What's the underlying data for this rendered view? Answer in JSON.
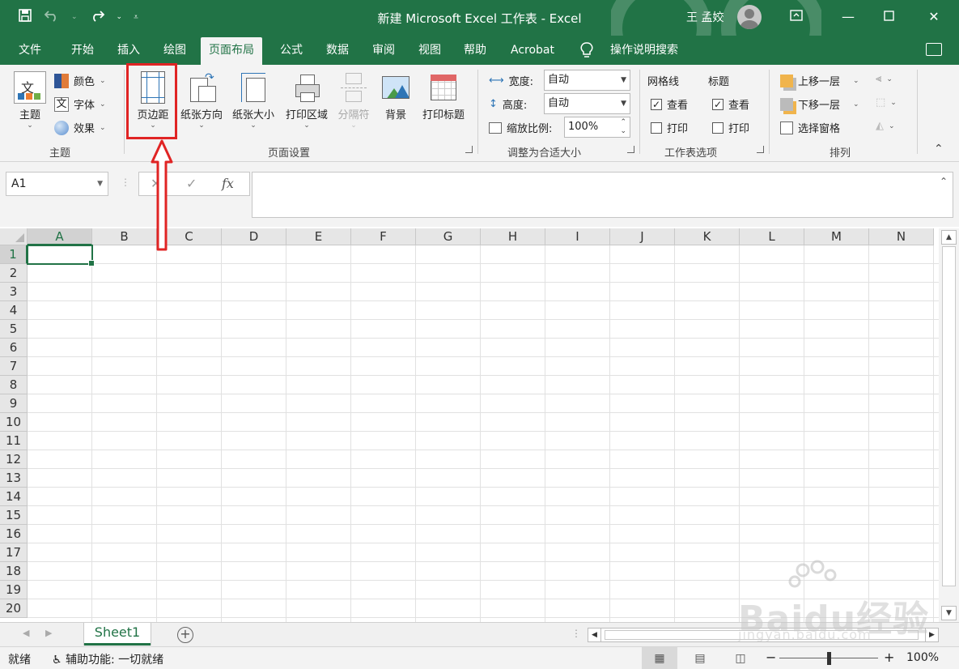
{
  "window": {
    "title": "新建 Microsoft Excel 工作表 - Excel",
    "user": "王 孟姣"
  },
  "tabs": [
    "文件",
    "开始",
    "插入",
    "绘图",
    "页面布局",
    "公式",
    "数据",
    "审阅",
    "视图",
    "帮助",
    "Acrobat",
    "操作说明搜索"
  ],
  "active_tab": "页面布局",
  "ribbon": {
    "theme": {
      "label": "主题",
      "theme_button": "主题",
      "colors": "颜色",
      "fonts": "字体",
      "effects": "效果",
      "theme_icon_glyph": "文"
    },
    "page_setup": {
      "label": "页面设置",
      "margins": "页边距",
      "orientation": "纸张方向",
      "size": "纸张大小",
      "print_area": "打印区域",
      "breaks": "分隔符",
      "background": "背景",
      "print_titles": "打印标题"
    },
    "scale_to_fit": {
      "label": "调整为合适大小",
      "width_label": "宽度:",
      "width_value": "自动",
      "height_label": "高度:",
      "height_value": "自动",
      "scale_label": "缩放比例:",
      "scale_value": "100%"
    },
    "sheet_options": {
      "label": "工作表选项",
      "gridlines": "网格线",
      "headings": "标题",
      "view": "查看",
      "print": "打印",
      "gridlines_view_checked": true,
      "gridlines_print_checked": false,
      "headings_view_checked": true,
      "headings_print_checked": false
    },
    "arrange": {
      "label": "排列",
      "bring_forward": "上移一层",
      "send_backward": "下移一层",
      "selection_pane": "选择窗格"
    }
  },
  "formula_bar": {
    "name_box": "A1",
    "cancel_glyph": "✕",
    "enter_glyph": "✓",
    "fx": "fx",
    "value": ""
  },
  "grid": {
    "columns": [
      "A",
      "B",
      "C",
      "D",
      "E",
      "F",
      "G",
      "H",
      "I",
      "J",
      "K",
      "L",
      "M",
      "N"
    ],
    "rows": [
      "1",
      "2",
      "3",
      "4",
      "5",
      "6",
      "7",
      "8",
      "9",
      "10",
      "11",
      "12",
      "13",
      "14",
      "15",
      "16",
      "17",
      "18",
      "19",
      "20"
    ],
    "active_cell": "A1"
  },
  "sheets": [
    "Sheet1"
  ],
  "status": {
    "ready": "就绪",
    "accessibility": "辅助功能: 一切就绪",
    "zoom": "100%"
  },
  "watermark": {
    "brand": "Baidu经验",
    "url": "jingyan.baidu.com"
  },
  "colors": {
    "excel_green": "#217346",
    "annotation_red": "#e02424"
  },
  "icons": {
    "save": "save-icon",
    "undo": "undo-icon",
    "redo": "redo-icon",
    "lightbulb": "lightbulb-icon",
    "comments": "comments-icon"
  }
}
